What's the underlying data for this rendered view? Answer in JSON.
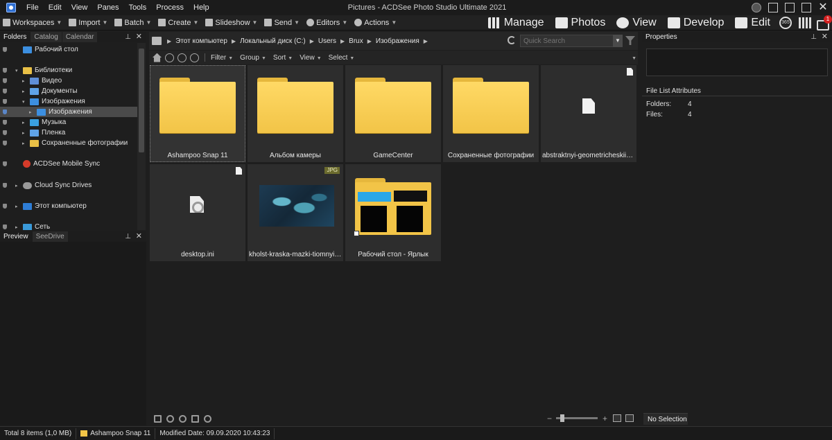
{
  "menu": [
    "File",
    "Edit",
    "View",
    "Panes",
    "Tools",
    "Process",
    "Help"
  ],
  "window_title": "Pictures - ACDSee Photo Studio Ultimate 2021",
  "toolbar": {
    "workspaces": "Workspaces",
    "import": "Import",
    "batch": "Batch",
    "create": "Create",
    "slideshow": "Slideshow",
    "send": "Send",
    "editors": "Editors",
    "actions": "Actions"
  },
  "modes": {
    "manage": "Manage",
    "photos": "Photos",
    "view": "View",
    "develop": "Develop",
    "edit": "Edit",
    "badge_365": "365",
    "notification_count": "1"
  },
  "folders_panel": {
    "tabs": [
      "Folders",
      "Catalog",
      "Calendar"
    ],
    "tree": [
      {
        "label": "Рабочий стол",
        "icon": "desktop-folder-icon",
        "level": 0,
        "expander": "",
        "marker": true
      },
      {
        "label": "Библиотеки",
        "icon": "libraries-folder-icon",
        "level": 0,
        "expander": "▾",
        "marker": true
      },
      {
        "label": "Видео",
        "icon": "video-library-icon",
        "level": 1,
        "expander": "▸",
        "marker": true
      },
      {
        "label": "Документы",
        "icon": "documents-library-icon",
        "level": 1,
        "expander": "▸",
        "marker": true
      },
      {
        "label": "Изображения",
        "icon": "pictures-library-icon",
        "level": 1,
        "expander": "▾",
        "marker": true
      },
      {
        "label": "Изображения",
        "icon": "pictures-folder-icon",
        "level": 2,
        "expander": "▸",
        "marker": true,
        "selected": true
      },
      {
        "label": "Музыка",
        "icon": "music-library-icon",
        "level": 1,
        "expander": "▸",
        "marker": true
      },
      {
        "label": "Пленка",
        "icon": "film-folder-icon",
        "level": 1,
        "expander": "▸",
        "marker": true
      },
      {
        "label": "Сохраненные фотографии",
        "icon": "saved-photos-folder-icon",
        "level": 1,
        "expander": "▸",
        "marker": true
      },
      {
        "label": "ACDSee Mobile Sync",
        "icon": "mobile-sync-icon",
        "level": 0,
        "expander": "",
        "marker": true
      },
      {
        "label": "Cloud Sync Drives",
        "icon": "cloud-icon",
        "level": 0,
        "expander": "▸",
        "marker": true
      },
      {
        "label": "Этот компьютер",
        "icon": "computer-icon",
        "level": 0,
        "expander": "▸",
        "marker": true
      },
      {
        "label": "Сеть",
        "icon": "network-icon",
        "level": 0,
        "expander": "▸",
        "marker": true
      }
    ]
  },
  "preview_panel": {
    "tabs": [
      "Preview",
      "SeeDrive"
    ]
  },
  "breadcrumb": [
    "Этот компьютер",
    "Локальный диск (C:)",
    "Users",
    "Brux",
    "Изображения"
  ],
  "search": {
    "placeholder": "Quick Search"
  },
  "filebar": [
    "Filter",
    "Group",
    "Sort",
    "View",
    "Select"
  ],
  "files": [
    {
      "name": "Ashampoo Snap 11",
      "type": "folder",
      "focused": true
    },
    {
      "name": "Альбом камеры",
      "type": "folder"
    },
    {
      "name": "GameCenter",
      "type": "folder"
    },
    {
      "name": "Сохраненные фотографии",
      "type": "folder"
    },
    {
      "name": "abstraktnyi-geometricheskii-l...",
      "type": "file"
    },
    {
      "name": "desktop.ini",
      "type": "ini"
    },
    {
      "name": "kholst-kraska-mazki-tiomnyi-...",
      "type": "jpg",
      "badge": "JPG"
    },
    {
      "name": "Рабочий стол - Ярлык",
      "type": "shortcut"
    }
  ],
  "properties": {
    "title": "Properties",
    "section": "File List Attributes",
    "attributes": [
      {
        "label": "Folders:",
        "value": "4"
      },
      {
        "label": "Files:",
        "value": "4"
      }
    ],
    "tab": "No Selection"
  },
  "status": {
    "total": "Total 8 items  (1,0 MB)",
    "current": "Ashampoo Snap 11",
    "modified": "Modified Date: 09.09.2020 10:43:23"
  }
}
